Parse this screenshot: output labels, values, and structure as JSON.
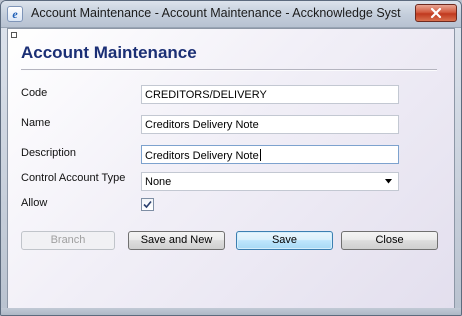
{
  "window": {
    "title": "Account Maintenance - Account Maintenance - Accknowledge Syste...",
    "app_icon_glyph": "e",
    "close_icon": "close-icon"
  },
  "form": {
    "heading": "Account Maintenance",
    "fields": {
      "code": {
        "label": "Code",
        "value": "CREDITORS/DELIVERY"
      },
      "name": {
        "label": "Name",
        "value": "Creditors Delivery Note"
      },
      "description": {
        "label": "Description",
        "value": "Creditors Delivery Note"
      },
      "control_account_type": {
        "label": "Control Account Type",
        "value": "None"
      },
      "allow": {
        "label": "Allow",
        "checked": true
      }
    }
  },
  "buttons": {
    "branch": "Branch",
    "save_and_new": "Save and New",
    "save": "Save",
    "close": "Close"
  },
  "colors": {
    "heading": "#1b2f75",
    "default_button_border": "#3c7fb1"
  }
}
